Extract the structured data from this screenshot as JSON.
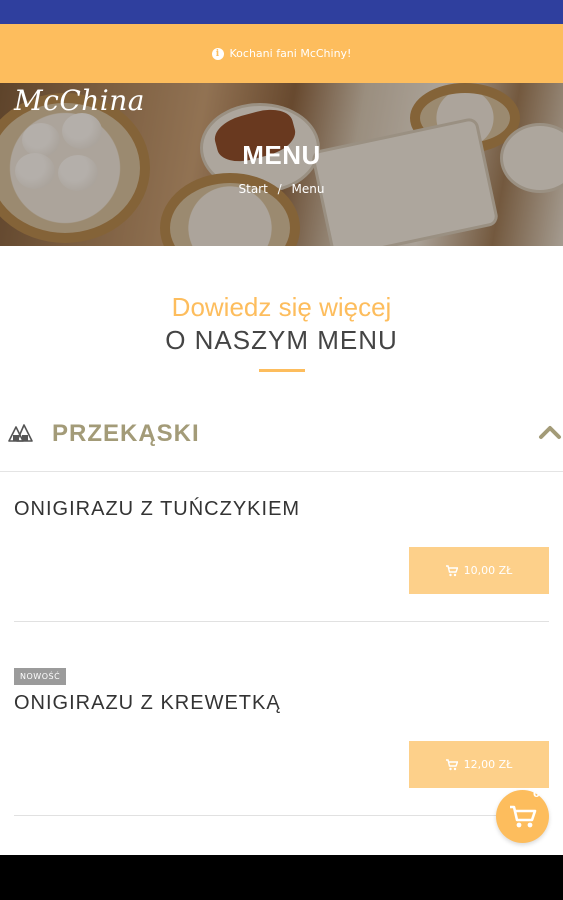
{
  "notice": {
    "icon": "info-icon",
    "text": "Kochani fani McChiny!"
  },
  "hero": {
    "logo": "McChina",
    "title": "MENU",
    "breadcrumb": {
      "start": "Start",
      "separator": "/",
      "current": "Menu"
    }
  },
  "intro": {
    "subtitle": "Dowiedz się więcej",
    "title": "O NASZYM MENU"
  },
  "category": {
    "icon": "onigiri-icon",
    "label": "PRZEKĄSKI",
    "toggle_icon": "chevron-up-icon"
  },
  "items": [
    {
      "name": "ONIGIRAZU Z TUŃCZYKIEM",
      "price": "10,00 ZŁ",
      "badge": ""
    },
    {
      "name": "ONIGIRAZU Z KREWETKĄ",
      "price": "12,00 ZŁ",
      "badge": "NOWOŚĆ"
    }
  ],
  "cart": {
    "icon": "cart-icon",
    "count": "0"
  },
  "colors": {
    "accent": "#fdbd5d",
    "status_bar": "#2f3f9e",
    "category_text": "#a39b78"
  }
}
